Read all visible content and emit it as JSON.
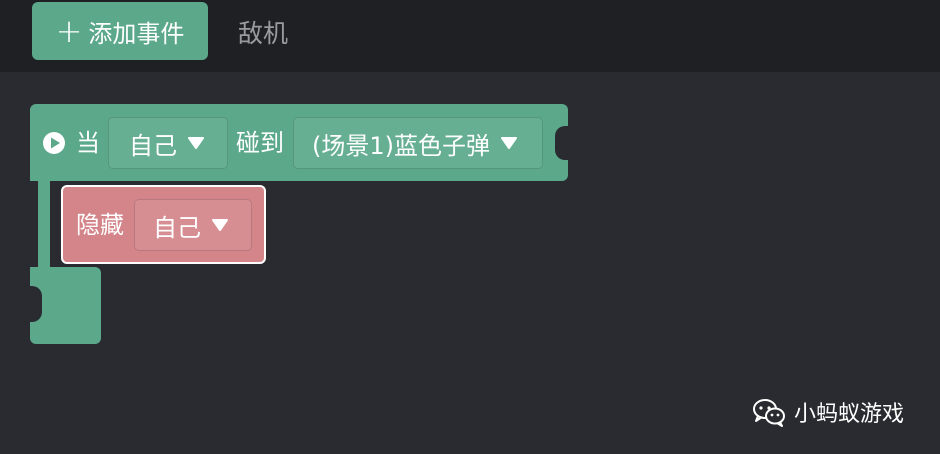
{
  "toolbar": {
    "add_event_label": "添加事件",
    "tab_enemy_label": "敌机"
  },
  "event": {
    "when_label": "当",
    "subject_value": "自己",
    "collide_label": "碰到",
    "target_value": "(场景1)蓝色子弹"
  },
  "action": {
    "hide_label": "隐藏",
    "hide_target_value": "自己"
  },
  "watermark": {
    "text": "小蚂蚁游戏"
  },
  "colors": {
    "event_block": "#5ba98a",
    "action_block": "#d4858a",
    "background": "#2a2b30",
    "topbar": "#1f2024"
  }
}
